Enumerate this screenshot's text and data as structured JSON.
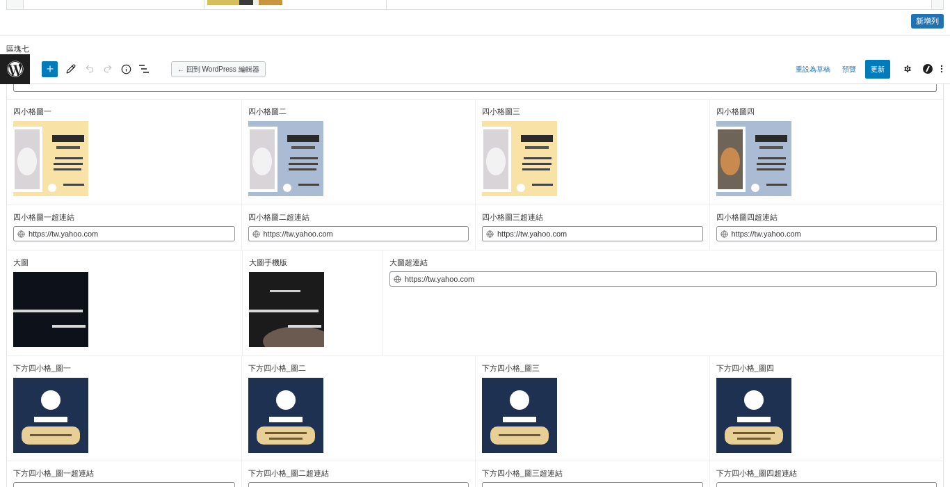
{
  "top_table": {
    "add_row_button": "新增列"
  },
  "section_title": "區塊七",
  "toolbar": {
    "back_button": "← 回到 WordPress 編輯器",
    "switch_to_draft": "重設為草稿",
    "preview": "預覽",
    "update": "更新"
  },
  "field_rows": [
    [
      {
        "label": "四小格圖一"
      },
      {
        "label": "四小格圖二"
      },
      {
        "label": "四小格圖三"
      },
      {
        "label": "四小格圖四"
      }
    ],
    [
      {
        "label": "四小格圖一超連結",
        "kind": "url",
        "value": "https://tw.yahoo.com"
      },
      {
        "label": "四小格圖二超連結",
        "kind": "url",
        "value": "https://tw.yahoo.com"
      },
      {
        "label": "四小格圖三超連結",
        "kind": "url",
        "value": "https://tw.yahoo.com"
      },
      {
        "label": "四小格圖四超連結",
        "kind": "url",
        "value": "https://tw.yahoo.com"
      }
    ],
    [
      {
        "label": "大圖"
      },
      {
        "label": "大圖手機版"
      },
      {
        "label": "大圖超連結",
        "kind": "url",
        "value": "https://tw.yahoo.com"
      }
    ],
    [
      {
        "label": "下方四小格_圖一"
      },
      {
        "label": "下方四小格_圖二"
      },
      {
        "label": "下方四小格_圖三"
      },
      {
        "label": "下方四小格_圖四"
      }
    ],
    [
      {
        "label": "下方四小格_圖一超連結",
        "kind": "url"
      },
      {
        "label": "下方四小格_圖二超連結",
        "kind": "url"
      },
      {
        "label": "下方四小格_圖三超連結",
        "kind": "url"
      },
      {
        "label": "下方四小格_圖四超連結",
        "kind": "url"
      }
    ]
  ]
}
